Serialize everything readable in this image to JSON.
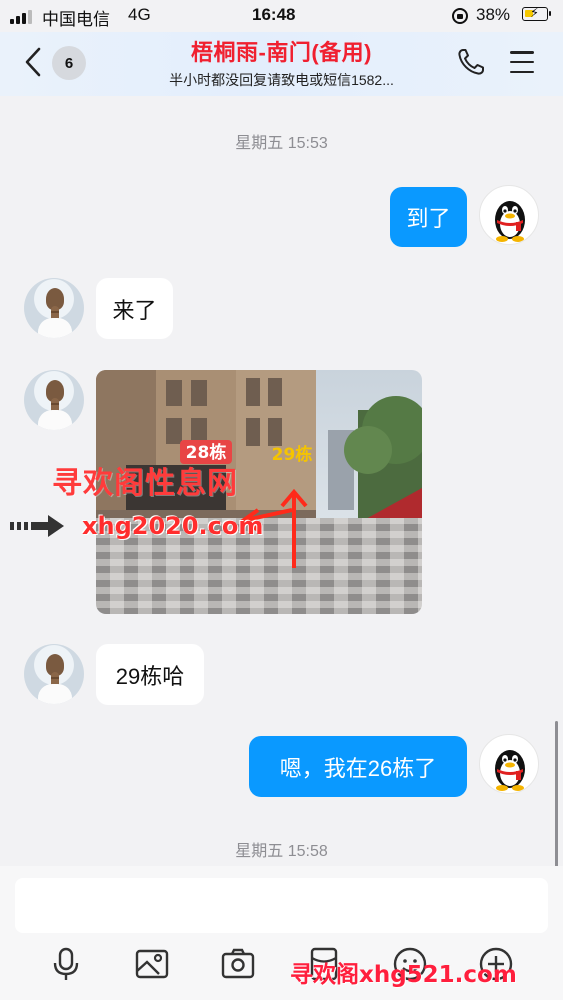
{
  "status_bar": {
    "carrier": "中国电信",
    "network": "4G",
    "time": "16:48",
    "battery": "38%",
    "battery_level": 0.38
  },
  "header": {
    "back_count": "6",
    "title": "梧桐雨-南门(备用)",
    "subtitle": "半小时都没回复请致电或短信1582..."
  },
  "chat": {
    "time_1": "星期五 15:53",
    "msg_out_1": "到了",
    "msg_in_1": "来了",
    "photo_labels": {
      "tag_28": "28栋",
      "tag_29": "29栋"
    },
    "msg_in_2": "29栋哈",
    "msg_out_2": "嗯，我在26栋了",
    "time_2": "星期五 15:58"
  },
  "watermarks": {
    "wm_1": "寻欢阁性息网",
    "wm_2": "xhg2020.com",
    "wm_3": "寻欢阁xhg521.com"
  },
  "input": {
    "placeholder": ""
  },
  "toolbar": {
    "icons": [
      "microphone-icon",
      "image-icon",
      "camera-icon",
      "red-packet-icon",
      "emoji-icon",
      "plus-icon"
    ]
  },
  "colors": {
    "accent_blue": "#0a99ff",
    "title_red": "#f02030",
    "background": "#f2f2f4"
  }
}
